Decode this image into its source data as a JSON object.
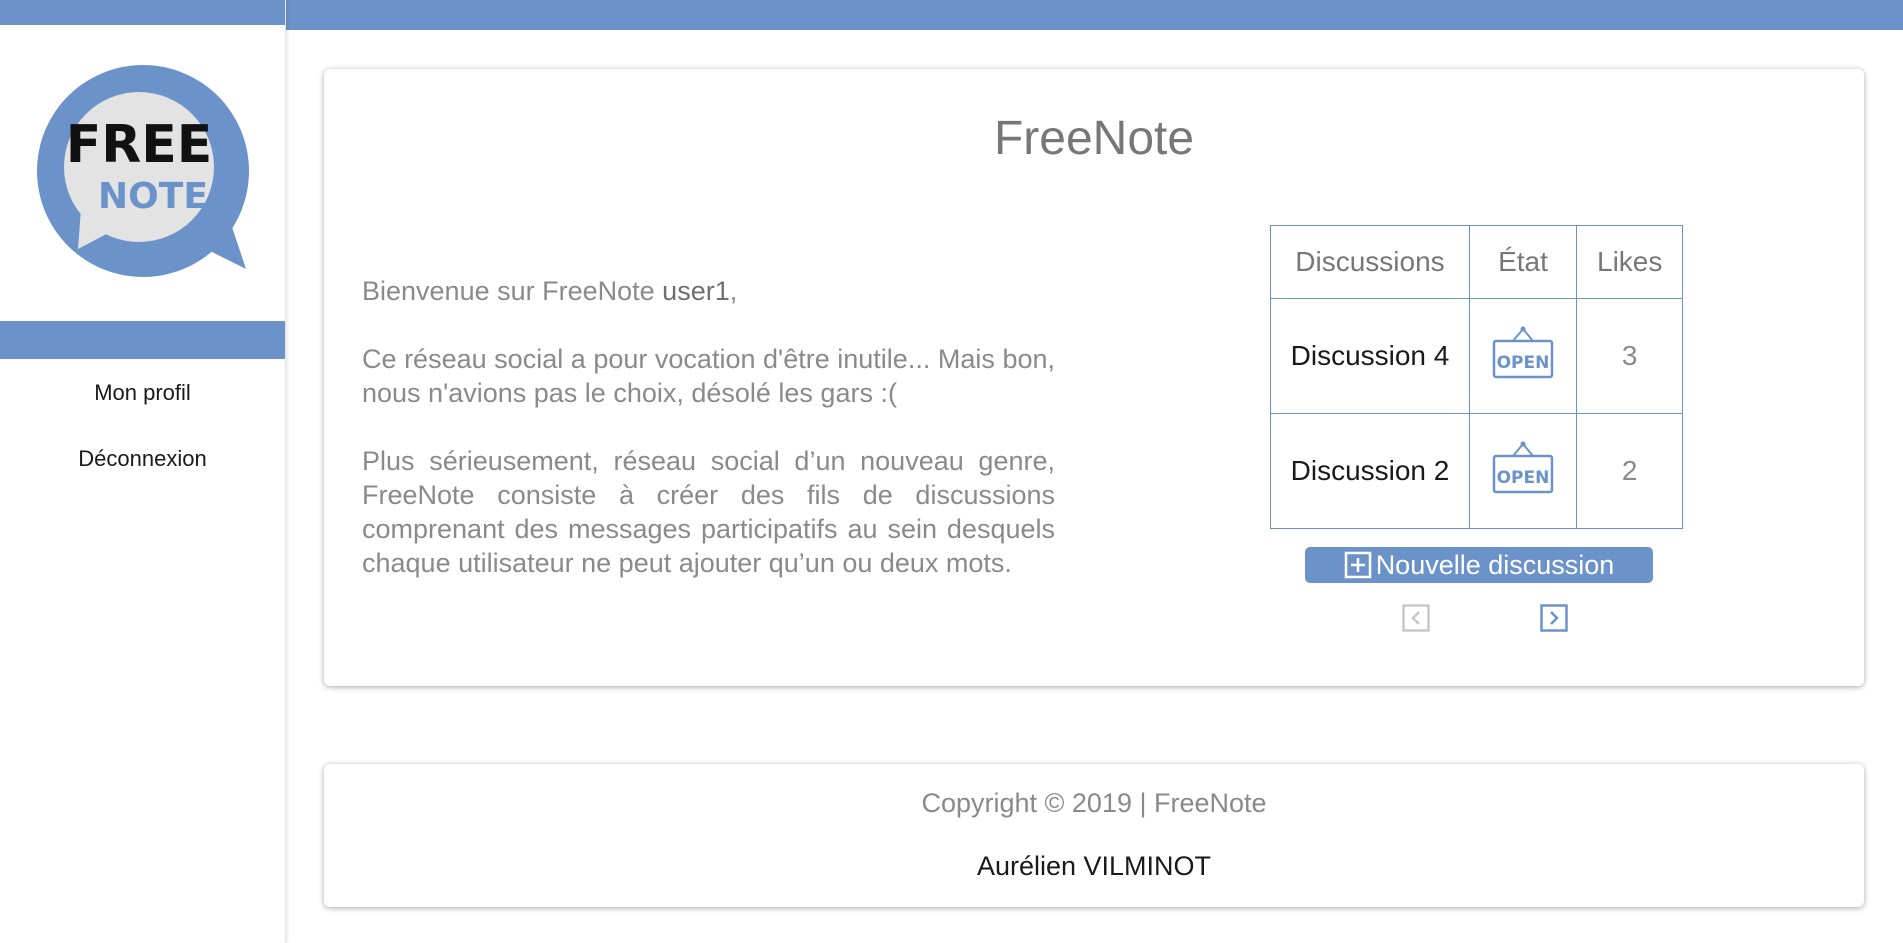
{
  "colors": {
    "accent": "#6b93c9",
    "text": "#7a7a7a",
    "dark": "#1a1a1a"
  },
  "logo": {
    "line1": "FREE",
    "line2": "NOTE"
  },
  "sidebar": {
    "items": [
      {
        "label": "Mon profil"
      },
      {
        "label": "Déconnexion"
      }
    ]
  },
  "main": {
    "title": "FreeNote",
    "intro": {
      "greeting_prefix": "Bienvenue sur FreeNote ",
      "username": "user1",
      "greeting_suffix": ",",
      "paragraph2": "Ce réseau social a pour vocation d'être inutile... Mais bon, nous n'avions pas le choix, désolé les gars :(",
      "paragraph3": "Plus sérieusement, réseau social d’un nouveau genre, FreeNote consiste à créer des fils de discussions comprenant des messages participatifs au sein desquels chaque utilisateur ne peut ajouter qu’un ou deux mots."
    },
    "table": {
      "headers": [
        "Discussions",
        "État",
        "Likes"
      ],
      "rows": [
        {
          "name": "Discussion 4",
          "state_icon": "open-sign-icon",
          "state_text": "OPEN",
          "likes": "3"
        },
        {
          "name": "Discussion 2",
          "state_icon": "open-sign-icon",
          "state_text": "OPEN",
          "likes": "2"
        }
      ]
    },
    "new_button_label": "Nouvelle discussion",
    "pagination": {
      "prev_icon": "chevron-left-icon",
      "next_icon": "chevron-right-icon"
    }
  },
  "footer": {
    "copyright": "Copyright © 2019 | FreeNote",
    "author": "Aurélien VILMINOT"
  }
}
